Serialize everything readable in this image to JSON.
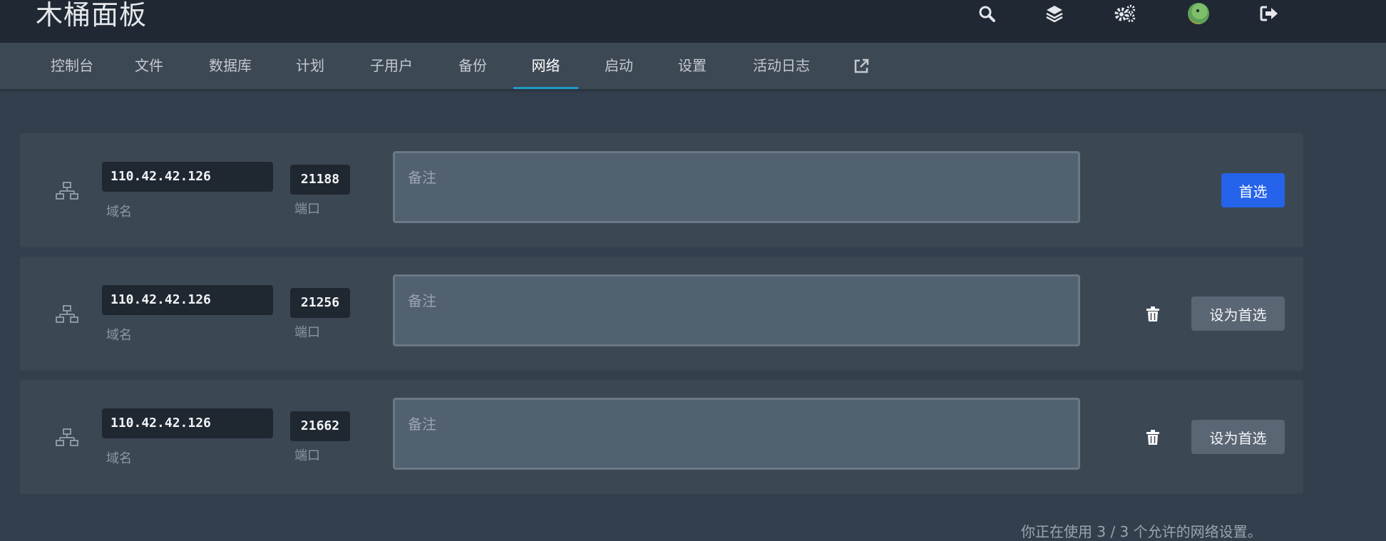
{
  "app": {
    "title": "木桶面板"
  },
  "topbar": {
    "icons": [
      "search-icon",
      "layers-icon",
      "cogs-icon",
      "avatar",
      "logout-icon"
    ]
  },
  "nav": {
    "tabs": [
      {
        "label": "控制台"
      },
      {
        "label": "文件"
      },
      {
        "label": "数据库"
      },
      {
        "label": "计划"
      },
      {
        "label": "子用户"
      },
      {
        "label": "备份"
      },
      {
        "label": "网络",
        "active": true
      },
      {
        "label": "启动"
      },
      {
        "label": "设置"
      },
      {
        "label": "活动日志"
      }
    ],
    "external_icon": "external-link-icon"
  },
  "allocations": [
    {
      "ip": "110.42.42.126",
      "ip_label": "域名",
      "port": "21188",
      "port_label": "端口",
      "note_value": "",
      "note_placeholder": "备注",
      "is_primary": true,
      "button_label": "首选"
    },
    {
      "ip": "110.42.42.126",
      "ip_label": "域名",
      "port": "21256",
      "port_label": "端口",
      "note_value": "",
      "note_placeholder": "备注",
      "is_primary": false,
      "button_label": "设为首选"
    },
    {
      "ip": "110.42.42.126",
      "ip_label": "域名",
      "port": "21662",
      "port_label": "端口",
      "note_value": "",
      "note_placeholder": "备注",
      "is_primary": false,
      "button_label": "设为首选"
    }
  ],
  "footer": {
    "usage_text": "你正在使用 3 / 3 个允许的网络设置。"
  },
  "colors": {
    "topbar": "#1f2833",
    "navbar": "#3d4855",
    "page_bg": "#333f4c",
    "card_bg": "#3c4754",
    "accent_tab": "#1c9bc6",
    "primary_button": "#2563eb",
    "secondary_button": "#5a6674"
  }
}
